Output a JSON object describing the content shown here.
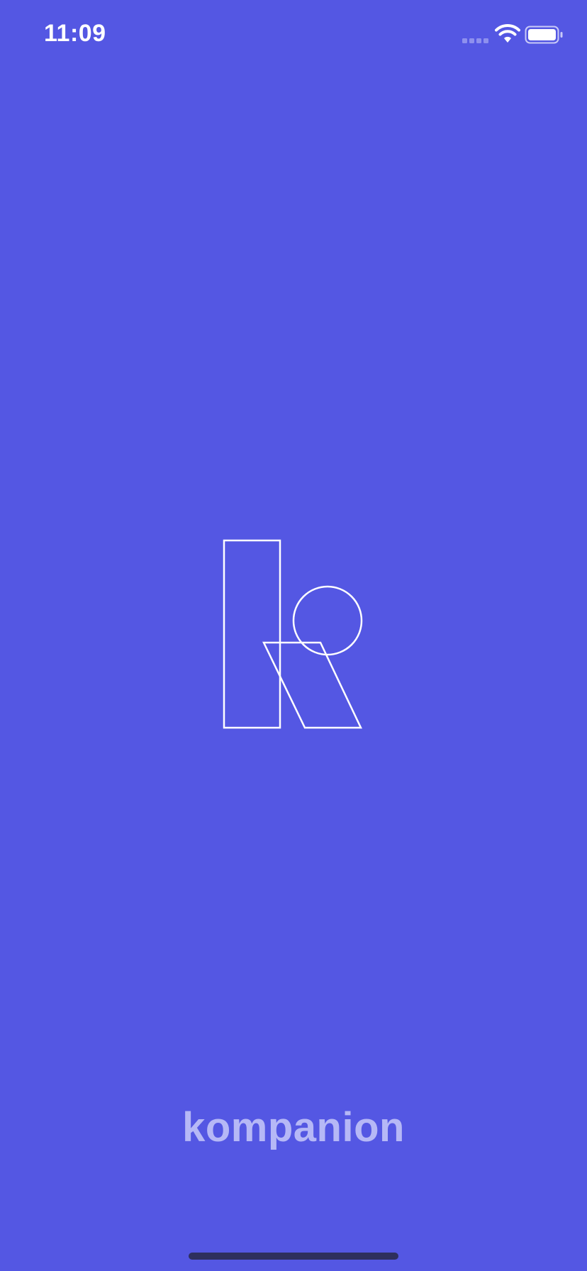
{
  "status_bar": {
    "time": "11:09",
    "signal_icon": "cellular-signal-icon",
    "wifi_icon": "wifi-icon",
    "battery_icon": "battery-icon"
  },
  "splash": {
    "logo_icon": "kompanion-k-logo-icon",
    "app_name": "kompanion"
  },
  "colors": {
    "background": "#5457E3",
    "logo_stroke": "#FFFFFF",
    "wordmark": "#B6B8F6",
    "home_indicator": "#2E2F5E"
  }
}
